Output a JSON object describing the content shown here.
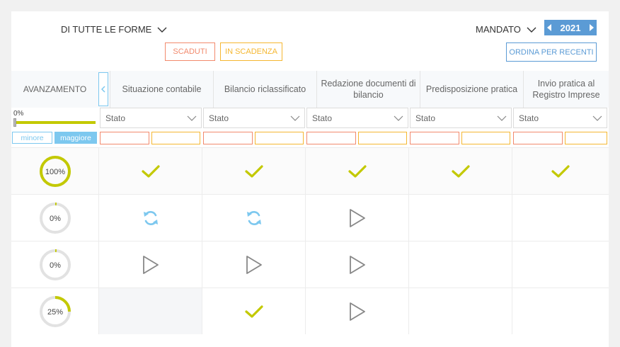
{
  "filters": {
    "forme_label": "DI TUTTE LE FORME",
    "scaduti_label": "SCADUTI",
    "in_scadenza_label": "IN SCADENZA",
    "mandato_label": "MANDATO",
    "year": "2021",
    "ordina_label": "ORDINA PER RECENTI"
  },
  "colors": {
    "accent_blue": "#5b9bd5",
    "light_blue": "#7dc8ef",
    "scaduti": "#f28a6d",
    "in_scadenza": "#f5b731",
    "progress_green": "#c3c900"
  },
  "table": {
    "avanzamento_label": "AVANZAMENTO",
    "columns": [
      "Situazione contabile",
      "Bilancio riclassificato",
      "Redazione documenti di bilancio",
      "Predisposizione pratica",
      "Invio pratica al Registro Imprese"
    ],
    "stato_placeholder": "Stato",
    "range_label": "0%",
    "minore_label": "minore",
    "maggiore_label": "maggiore",
    "rows": [
      {
        "progress": 100,
        "progress_label": "100%",
        "cells": [
          "check-icon",
          "check-icon",
          "check-icon",
          "check-icon",
          "check-icon"
        ]
      },
      {
        "progress": 0,
        "progress_label": "0%",
        "cells": [
          "sync-icon",
          "sync-icon",
          "play-icon",
          "",
          ""
        ]
      },
      {
        "progress": 0,
        "progress_label": "0%",
        "cells": [
          "play-icon",
          "play-icon",
          "play-icon",
          "",
          ""
        ]
      },
      {
        "progress": 25,
        "progress_label": "25%",
        "cells": [
          "",
          "check-icon",
          "play-icon",
          "",
          ""
        ]
      }
    ]
  }
}
